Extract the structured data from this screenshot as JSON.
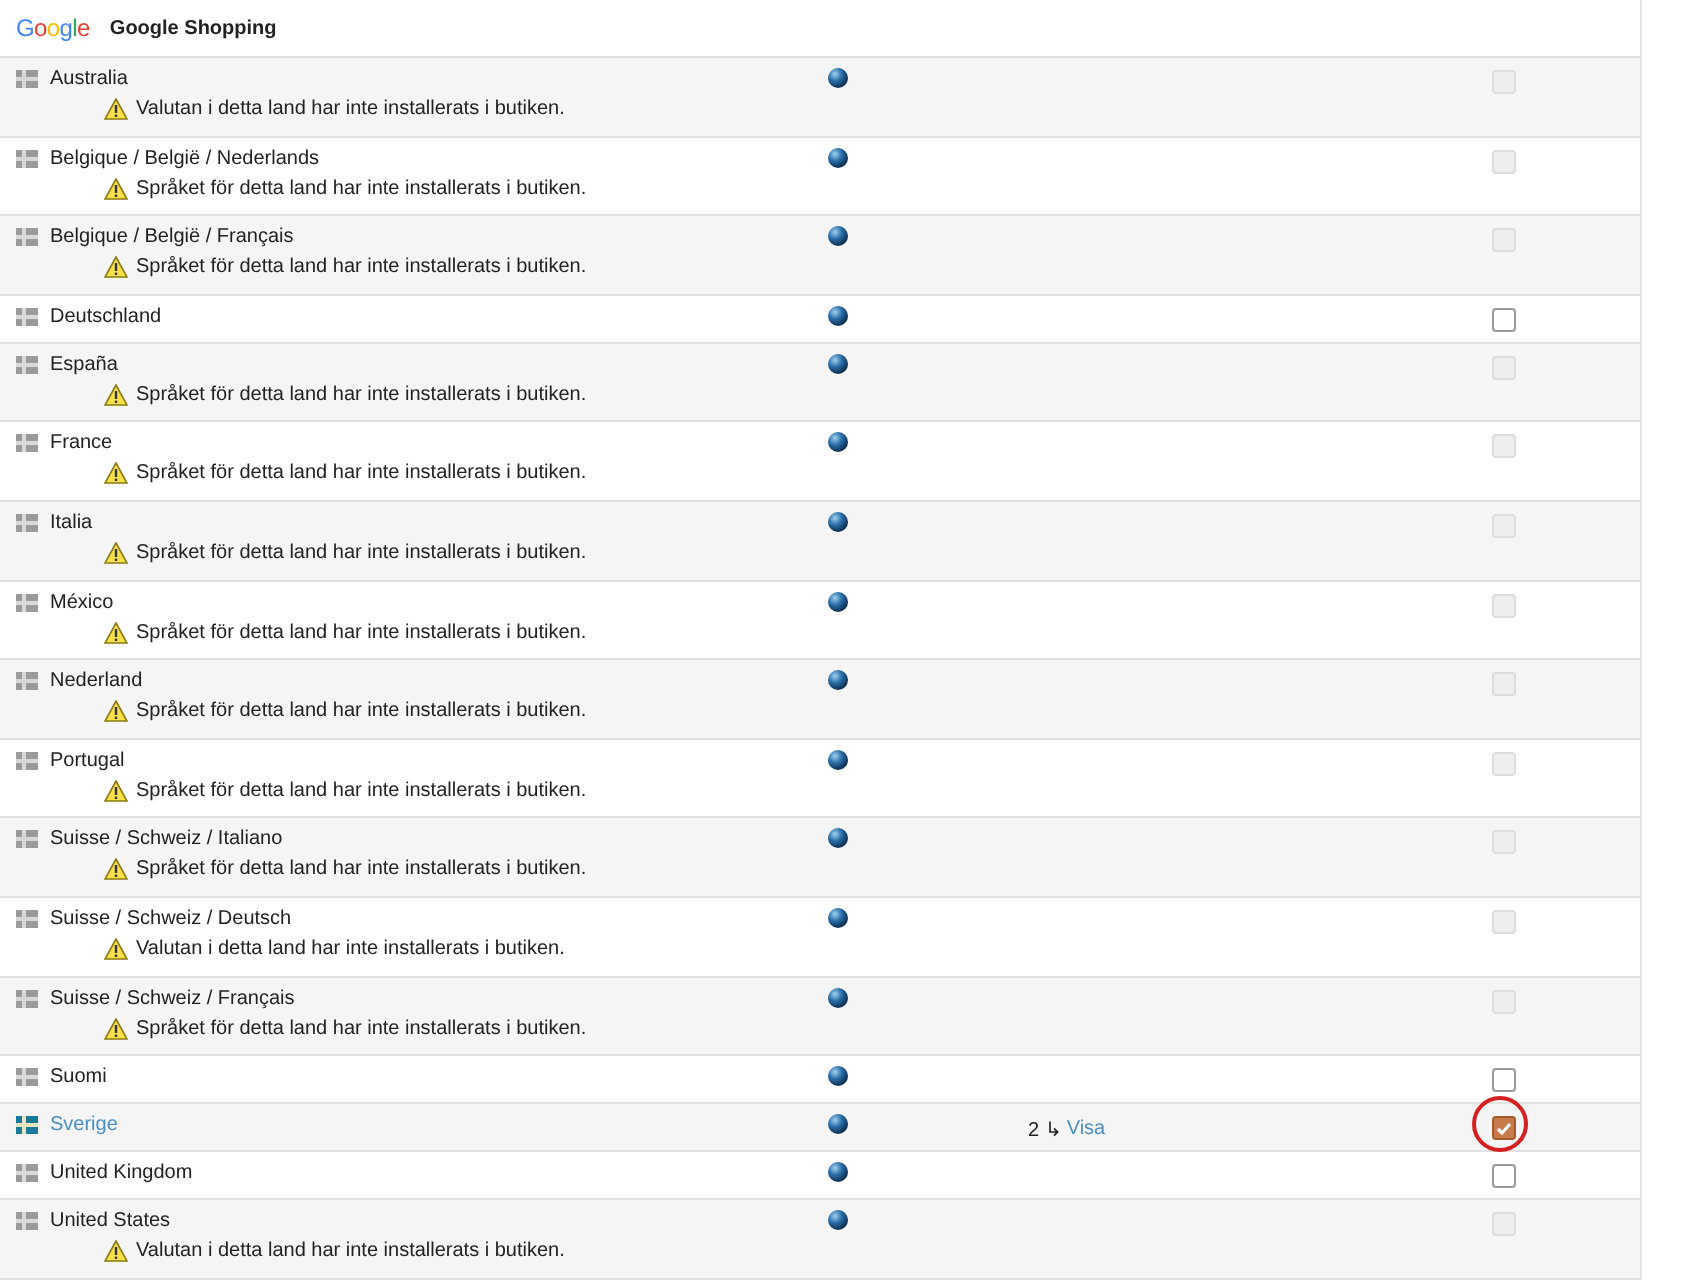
{
  "header": {
    "logo": "Google",
    "title": "Google Shopping"
  },
  "rows": [
    {
      "name": "Australia",
      "warning": "Valutan i detta land har inte installerats i butiken.",
      "disabled": true,
      "checked": false,
      "selected": false
    },
    {
      "name": "Belgique / België / Nederlands",
      "warning": "Språket för detta land har inte installerats i butiken.",
      "disabled": true,
      "checked": false,
      "selected": false
    },
    {
      "name": "Belgique / België / Français",
      "warning": "Språket för detta land har inte installerats i butiken.",
      "disabled": true,
      "checked": false,
      "selected": false
    },
    {
      "name": "Deutschland",
      "disabled": false,
      "checked": false,
      "selected": false
    },
    {
      "name": "España",
      "warning": "Språket för detta land har inte installerats i butiken.",
      "disabled": true,
      "checked": false,
      "selected": false
    },
    {
      "name": "France",
      "warning": "Språket för detta land har inte installerats i butiken.",
      "disabled": true,
      "checked": false,
      "selected": false
    },
    {
      "name": "Italia",
      "warning": "Språket för detta land har inte installerats i butiken.",
      "disabled": true,
      "checked": false,
      "selected": false
    },
    {
      "name": "México",
      "warning": "Språket för detta land har inte installerats i butiken.",
      "disabled": true,
      "checked": false,
      "selected": false
    },
    {
      "name": "Nederland",
      "warning": "Språket för detta land har inte installerats i butiken.",
      "disabled": true,
      "checked": false,
      "selected": false
    },
    {
      "name": "Portugal",
      "warning": "Språket för detta land har inte installerats i butiken.",
      "disabled": true,
      "checked": false,
      "selected": false
    },
    {
      "name": "Suisse / Schweiz / Italiano",
      "warning": "Språket för detta land har inte installerats i butiken.",
      "disabled": true,
      "checked": false,
      "selected": false
    },
    {
      "name": "Suisse / Schweiz / Deutsch",
      "warning": "Valutan i detta land har inte installerats i butiken.",
      "disabled": true,
      "checked": false,
      "selected": false
    },
    {
      "name": "Suisse / Schweiz / Français",
      "warning": "Språket för detta land har inte installerats i butiken.",
      "disabled": true,
      "checked": false,
      "selected": false
    },
    {
      "name": "Suomi",
      "disabled": false,
      "checked": false,
      "selected": false
    },
    {
      "name": "Sverige",
      "disabled": false,
      "checked": true,
      "selected": true,
      "highlighted": true,
      "count": "2",
      "arrow": "↳",
      "link": "Visa"
    },
    {
      "name": "United Kingdom",
      "disabled": false,
      "checked": false,
      "selected": false
    },
    {
      "name": "United States",
      "warning": "Valutan i detta land har inte installerats i butiken.",
      "disabled": true,
      "checked": false,
      "selected": false
    }
  ]
}
